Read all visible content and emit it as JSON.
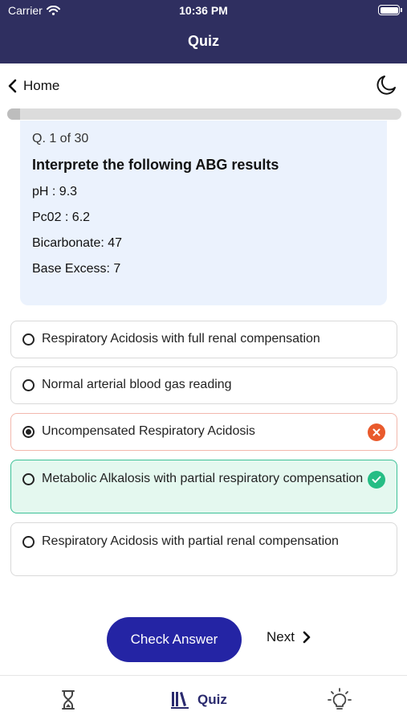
{
  "status_bar": {
    "carrier": "Carrier",
    "time": "10:36 PM"
  },
  "nav": {
    "title": "Quiz",
    "back_label": "Home"
  },
  "progress": {
    "fraction": 0.0333
  },
  "question": {
    "number": "Q. 1 of 30",
    "title": "Interprete the following ABG results",
    "lines": [
      "pH : 9.3",
      "Pc02 : 6.2",
      "Bicarbonate: 47",
      "Base Excess: 7"
    ]
  },
  "options": [
    {
      "label": "Respiratory Acidosis with full renal compensation",
      "selected": false,
      "state": "none"
    },
    {
      "label": "Normal arterial blood gas reading",
      "selected": false,
      "state": "none"
    },
    {
      "label": "Uncompensated Respiratory Acidosis",
      "selected": true,
      "state": "wrong"
    },
    {
      "label": "Metabolic Alkalosis with partial respiratory compensation",
      "selected": false,
      "state": "correct"
    },
    {
      "label": "Respiratory Acidosis with partial renal compensation",
      "selected": false,
      "state": "none"
    }
  ],
  "actions": {
    "check_label": "Check Answer",
    "next_label": "Next"
  },
  "tabbar": {
    "quiz_label": "Quiz"
  },
  "colors": {
    "header": "#2f2f60",
    "accent": "#2424a4",
    "wrong": "#e95a2c",
    "correct": "#25bd84",
    "card": "#ebf2fd"
  },
  "icons": {
    "back": "chevron-left-icon",
    "dark_mode": "moon-icon",
    "next": "chevron-right-icon",
    "tab_timer": "hourglass-icon",
    "tab_quiz": "books-icon",
    "tab_tips": "lightbulb-icon"
  }
}
